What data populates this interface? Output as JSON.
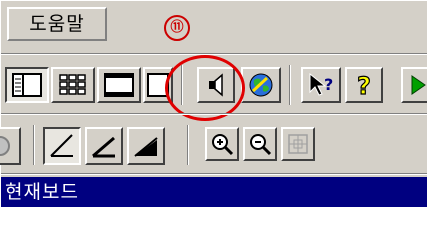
{
  "menu": {
    "help_label": "도움말"
  },
  "annotation": {
    "number": "⑪"
  },
  "toolbar1": {
    "buttons": [
      "layout-split-view-icon",
      "grid-view-icon",
      "filmstrip-view-icon",
      "single-view-icon",
      "speaker-icon",
      "globe-icon",
      "whats-this-help-icon",
      "help-icon",
      "play-icon"
    ]
  },
  "toolbar2": {
    "buttons": [
      "partial-circle-icon",
      "draw-line-icon",
      "draw-line-thick-icon",
      "draw-line-filled-icon",
      "zoom-in-icon",
      "zoom-out-icon",
      "fit-icon"
    ]
  },
  "board": {
    "title": "현재보드"
  },
  "colors": {
    "titlebar": "#000080",
    "annotation": "#e00000",
    "play_green": "#00a000",
    "help_yellow": "#ffff00"
  }
}
